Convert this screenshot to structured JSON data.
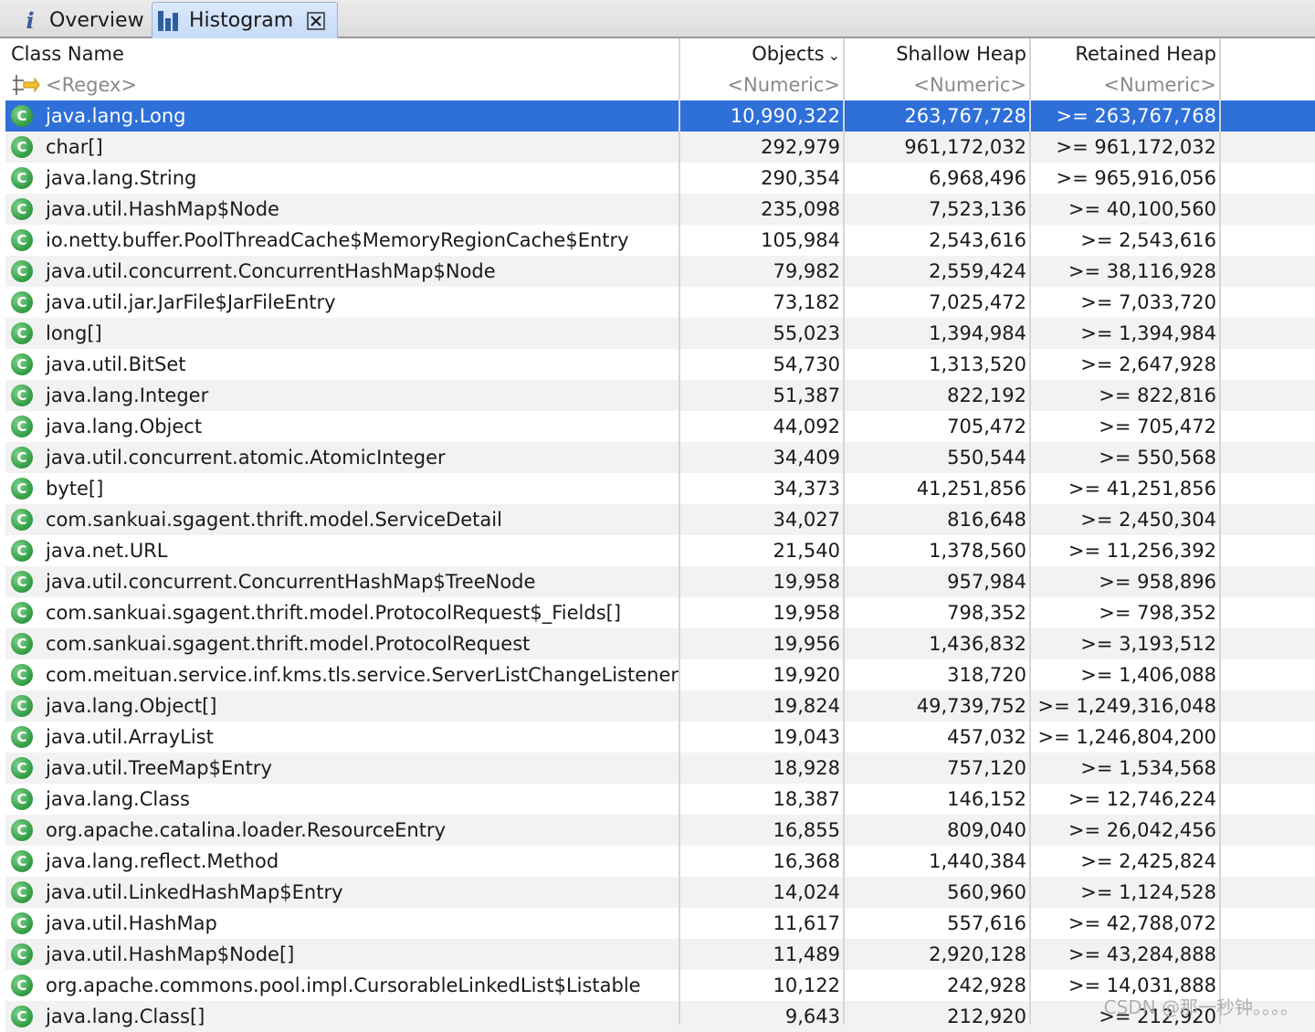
{
  "tabs": {
    "overview_label": "Overview",
    "histogram_label": "Histogram"
  },
  "columns": {
    "class_name": "Class Name",
    "objects": "Objects",
    "shallow_heap": "Shallow Heap",
    "retained_heap": "Retained Heap"
  },
  "filters": {
    "class_name": "<Regex>",
    "objects": "<Numeric>",
    "shallow_heap": "<Numeric>",
    "retained_heap": "<Numeric>"
  },
  "icon_names": {
    "class": "class-icon",
    "regex": "regex-filter-icon",
    "sort": "chevron-down-icon"
  },
  "colors": {
    "selection": "#2e6fd8",
    "class_icon": "#2e9a42",
    "tab_active": "#c6dbf7"
  },
  "selected_row_index": 0,
  "rows": [
    {
      "name": "java.lang.Long",
      "objects": "10,990,322",
      "shallow": "263,767,728",
      "retained": ">= 263,767,768"
    },
    {
      "name": "char[]",
      "objects": "292,979",
      "shallow": "961,172,032",
      "retained": ">= 961,172,032"
    },
    {
      "name": "java.lang.String",
      "objects": "290,354",
      "shallow": "6,968,496",
      "retained": ">= 965,916,056"
    },
    {
      "name": "java.util.HashMap$Node",
      "objects": "235,098",
      "shallow": "7,523,136",
      "retained": ">= 40,100,560"
    },
    {
      "name": "io.netty.buffer.PoolThreadCache$MemoryRegionCache$Entry",
      "objects": "105,984",
      "shallow": "2,543,616",
      "retained": ">= 2,543,616"
    },
    {
      "name": "java.util.concurrent.ConcurrentHashMap$Node",
      "objects": "79,982",
      "shallow": "2,559,424",
      "retained": ">= 38,116,928"
    },
    {
      "name": "java.util.jar.JarFile$JarFileEntry",
      "objects": "73,182",
      "shallow": "7,025,472",
      "retained": ">= 7,033,720"
    },
    {
      "name": "long[]",
      "objects": "55,023",
      "shallow": "1,394,984",
      "retained": ">= 1,394,984"
    },
    {
      "name": "java.util.BitSet",
      "objects": "54,730",
      "shallow": "1,313,520",
      "retained": ">= 2,647,928"
    },
    {
      "name": "java.lang.Integer",
      "objects": "51,387",
      "shallow": "822,192",
      "retained": ">= 822,816"
    },
    {
      "name": "java.lang.Object",
      "objects": "44,092",
      "shallow": "705,472",
      "retained": ">= 705,472"
    },
    {
      "name": "java.util.concurrent.atomic.AtomicInteger",
      "objects": "34,409",
      "shallow": "550,544",
      "retained": ">= 550,568"
    },
    {
      "name": "byte[]",
      "objects": "34,373",
      "shallow": "41,251,856",
      "retained": ">= 41,251,856"
    },
    {
      "name": "com.sankuai.sgagent.thrift.model.ServiceDetail",
      "objects": "34,027",
      "shallow": "816,648",
      "retained": ">= 2,450,304"
    },
    {
      "name": "java.net.URL",
      "objects": "21,540",
      "shallow": "1,378,560",
      "retained": ">= 11,256,392"
    },
    {
      "name": "java.util.concurrent.ConcurrentHashMap$TreeNode",
      "objects": "19,958",
      "shallow": "957,984",
      "retained": ">= 958,896"
    },
    {
      "name": "com.sankuai.sgagent.thrift.model.ProtocolRequest$_Fields[]",
      "objects": "19,958",
      "shallow": "798,352",
      "retained": ">= 798,352"
    },
    {
      "name": "com.sankuai.sgagent.thrift.model.ProtocolRequest",
      "objects": "19,956",
      "shallow": "1,436,832",
      "retained": ">= 3,193,512"
    },
    {
      "name": "com.meituan.service.inf.kms.tls.service.ServerListChangeListener",
      "objects": "19,920",
      "shallow": "318,720",
      "retained": ">= 1,406,088"
    },
    {
      "name": "java.lang.Object[]",
      "objects": "19,824",
      "shallow": "49,739,752",
      "retained": ">= 1,249,316,048"
    },
    {
      "name": "java.util.ArrayList",
      "objects": "19,043",
      "shallow": "457,032",
      "retained": ">= 1,246,804,200"
    },
    {
      "name": "java.util.TreeMap$Entry",
      "objects": "18,928",
      "shallow": "757,120",
      "retained": ">= 1,534,568"
    },
    {
      "name": "java.lang.Class",
      "objects": "18,387",
      "shallow": "146,152",
      "retained": ">= 12,746,224"
    },
    {
      "name": "org.apache.catalina.loader.ResourceEntry",
      "objects": "16,855",
      "shallow": "809,040",
      "retained": ">= 26,042,456"
    },
    {
      "name": "java.lang.reflect.Method",
      "objects": "16,368",
      "shallow": "1,440,384",
      "retained": ">= 2,425,824"
    },
    {
      "name": "java.util.LinkedHashMap$Entry",
      "objects": "14,024",
      "shallow": "560,960",
      "retained": ">= 1,124,528"
    },
    {
      "name": "java.util.HashMap",
      "objects": "11,617",
      "shallow": "557,616",
      "retained": ">= 42,788,072"
    },
    {
      "name": "java.util.HashMap$Node[]",
      "objects": "11,489",
      "shallow": "2,920,128",
      "retained": ">= 43,284,888"
    },
    {
      "name": "org.apache.commons.pool.impl.CursorableLinkedList$Listable",
      "objects": "10,122",
      "shallow": "242,928",
      "retained": ">= 14,031,888"
    },
    {
      "name": "java.lang.Class[]",
      "objects": "9,643",
      "shallow": "212,920",
      "retained": ">= 212,920"
    }
  ],
  "watermark": "CSDN @那一秒钟。。。。"
}
